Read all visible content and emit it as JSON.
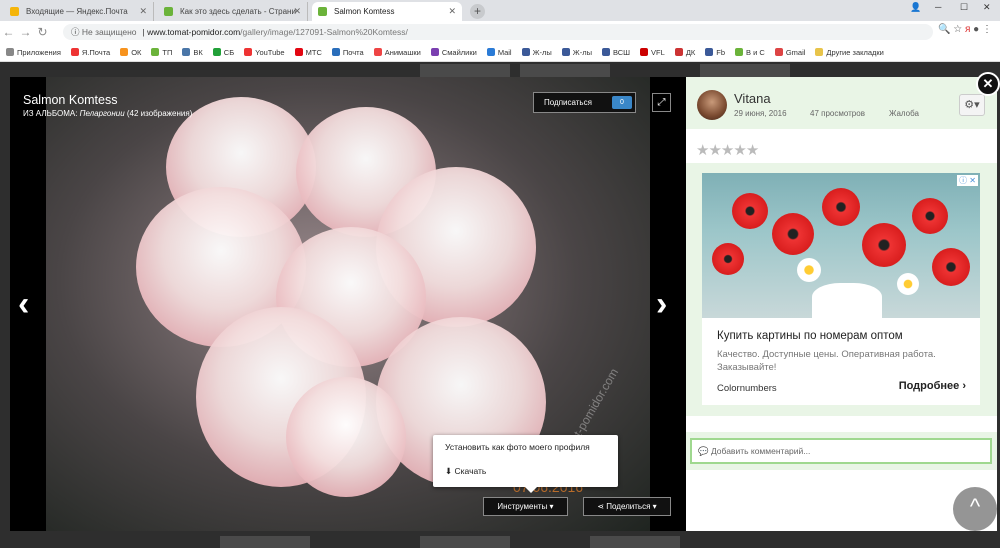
{
  "tabs": [
    {
      "label": "Входящие — Яндекс.Почта",
      "color": "#f5b50a",
      "active": false
    },
    {
      "label": "Как это здесь сделать - Страни",
      "color": "#6bb33a",
      "active": false
    },
    {
      "label": "Salmon Komtess",
      "color": "#6bb33a",
      "active": true
    }
  ],
  "address": {
    "not_secure": "Не защищено",
    "domain": "www.tomat-pomidor.com",
    "path": "/gallery/image/127091-Salmon%20Komtess/"
  },
  "bookmarks": [
    {
      "label": "Приложения",
      "color": "#888"
    },
    {
      "label": "Я.Почта",
      "color": "#e33"
    },
    {
      "label": "ОК",
      "color": "#f7931e"
    },
    {
      "label": "ТП",
      "color": "#6bb33a"
    },
    {
      "label": "ВК",
      "color": "#4a76a8"
    },
    {
      "label": "СБ",
      "color": "#21a038"
    },
    {
      "label": "YouTube",
      "color": "#e33"
    },
    {
      "label": "МТС",
      "color": "#e30611"
    },
    {
      "label": "Почта",
      "color": "#2a6ebb"
    },
    {
      "label": "Анимашки",
      "color": "#e44"
    },
    {
      "label": "Смайлики",
      "color": "#7a3fb0"
    },
    {
      "label": "Mail",
      "color": "#2b7bd6"
    },
    {
      "label": "Ж-лы",
      "color": "#3b5998"
    },
    {
      "label": "Ж-лы",
      "color": "#3b5998"
    },
    {
      "label": "ВСШ",
      "color": "#3b5998"
    },
    {
      "label": "VFL",
      "color": "#c00"
    },
    {
      "label": "ДК",
      "color": "#c33"
    },
    {
      "label": "Fb",
      "color": "#3b5998"
    },
    {
      "label": "В и С",
      "color": "#6bb33a"
    },
    {
      "label": "Gmail",
      "color": "#d44"
    },
    {
      "label": "Другие закладки",
      "color": "#e8c44a"
    }
  ],
  "image": {
    "title": "Salmon Komtess",
    "album_prefix": "ИЗ АЛЬБОМА:",
    "album_name": "Пеларгонии",
    "album_count": "(42 изображения)"
  },
  "viewer": {
    "subscribe": "Подписаться",
    "subscribe_count": "0",
    "tools": "Инструменты",
    "share": "Поделиться",
    "watermark": "07.06.2016",
    "watermark_site": "tomat-pomidor.com"
  },
  "tools_menu": {
    "set_profile": "Установить как фото моего профиля",
    "download": "Скачать"
  },
  "author": {
    "name": "Vitana",
    "date": "29 июня, 2016",
    "views": "47 просмотров",
    "report": "Жалоба"
  },
  "rating": {
    "stars": 5,
    "value": 0
  },
  "ad": {
    "title": "Купить картины по номерам оптом",
    "desc": "Качество. Доступные цены. Оперативная работа. Заказывайте!",
    "site": "Colornumbers",
    "more": "Подробнее"
  },
  "comment": {
    "placeholder": "Добавить комментарий..."
  }
}
